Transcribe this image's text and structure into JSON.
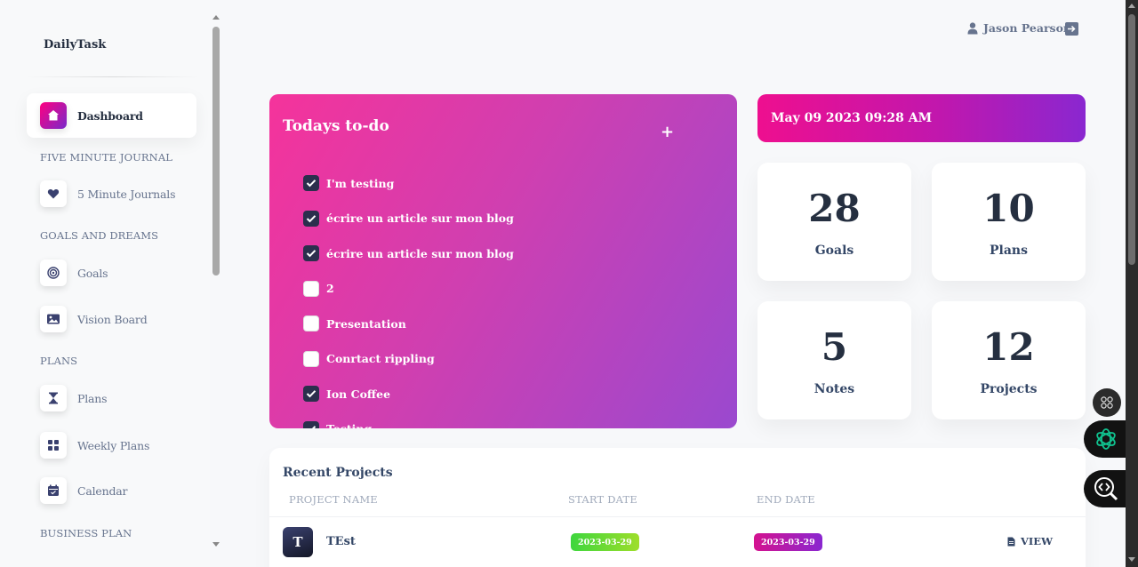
{
  "brand": "DailyTask",
  "sidebar": {
    "items": [
      {
        "label": "Dashboard",
        "icon": "home-icon",
        "active": true
      },
      {
        "section": "FIVE MINUTE JOURNAL"
      },
      {
        "label": "5 Minute Journals",
        "icon": "heart-icon"
      },
      {
        "section": "GOALS AND DREAMS"
      },
      {
        "label": "Goals",
        "icon": "target-icon"
      },
      {
        "label": "Vision Board",
        "icon": "image-icon"
      },
      {
        "section": "PLANS"
      },
      {
        "label": "Plans",
        "icon": "hourglass-icon"
      },
      {
        "label": "Weekly Plans",
        "icon": "grid-icon"
      },
      {
        "label": "Calendar",
        "icon": "calendar-icon"
      },
      {
        "section": "BUSINESS PLAN"
      }
    ]
  },
  "user": {
    "name": "Jason Pearson",
    "icon": "user-icon",
    "logout_icon": "logout-icon"
  },
  "todo": {
    "title": "Todays to-do",
    "add_label": "+",
    "items": [
      {
        "text": "I'm testing",
        "checked": true
      },
      {
        "text": "écrire un article sur mon blog",
        "checked": true
      },
      {
        "text": "écrire un article sur mon blog",
        "checked": true
      },
      {
        "text": "2",
        "checked": false
      },
      {
        "text": "Presentation",
        "checked": false
      },
      {
        "text": "Conrtact rippling",
        "checked": false
      },
      {
        "text": "Ion Coffee",
        "checked": true
      },
      {
        "text": "Testing",
        "checked": true
      }
    ]
  },
  "datetime": "May 09 2023 09:28 AM",
  "stats": [
    {
      "value": "28",
      "label": "Goals"
    },
    {
      "value": "10",
      "label": "Plans"
    },
    {
      "value": "5",
      "label": "Notes"
    },
    {
      "value": "12",
      "label": "Projects"
    }
  ],
  "projects": {
    "title": "Recent Projects",
    "columns": [
      "PROJECT NAME",
      "START DATE",
      "END DATE"
    ],
    "rows": [
      {
        "avatar": "T",
        "name": "TEst",
        "start": "2023-03-29",
        "end": "2023-03-29",
        "action": "VIEW"
      }
    ]
  },
  "colors": {
    "accent": "#cb0c9f",
    "todo_gradient_start": "#f5339b",
    "todo_gradient_end": "#9a49cf",
    "text_dark": "#252f40"
  }
}
